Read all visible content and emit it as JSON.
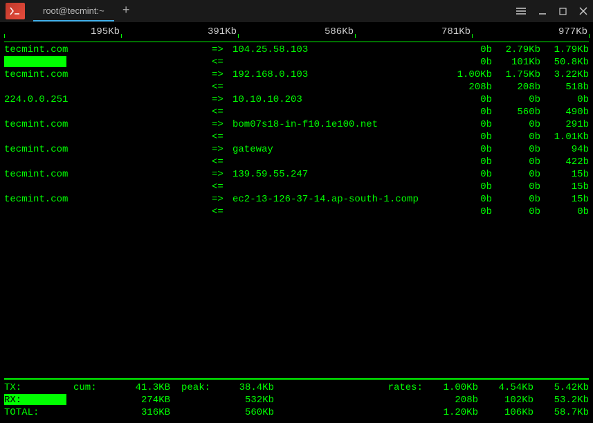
{
  "window": {
    "tab_title": "root@tecmint:~"
  },
  "scale": {
    "ticks": [
      "195Kb",
      "391Kb",
      "586Kb",
      "781Kb",
      "977Kb"
    ]
  },
  "connections": [
    {
      "host": "tecmint.com",
      "arrow_out": "=>",
      "remote": "104.25.58.103",
      "out": [
        "0b",
        "2.79Kb",
        "1.79Kb"
      ],
      "arrow_in": "<=",
      "in": [
        "0b",
        "101Kb",
        "50.8Kb"
      ],
      "host_in_bar": true
    },
    {
      "host": "tecmint.com",
      "arrow_out": "=>",
      "remote": "192.168.0.103",
      "out": [
        "1.00Kb",
        "1.75Kb",
        "3.22Kb"
      ],
      "arrow_in": "<=",
      "in": [
        "208b",
        "208b",
        "518b"
      ]
    },
    {
      "host": "224.0.0.251",
      "arrow_out": "=>",
      "remote": "10.10.10.203",
      "out": [
        "0b",
        "0b",
        "0b"
      ],
      "arrow_in": "<=",
      "in": [
        "0b",
        "560b",
        "490b"
      ]
    },
    {
      "host": "tecmint.com",
      "arrow_out": "=>",
      "remote": "bom07s18-in-f10.1e100.net",
      "out": [
        "0b",
        "0b",
        "291b"
      ],
      "arrow_in": "<=",
      "in": [
        "0b",
        "0b",
        "1.01Kb"
      ]
    },
    {
      "host": "tecmint.com",
      "arrow_out": "=>",
      "remote": "gateway",
      "out": [
        "0b",
        "0b",
        "94b"
      ],
      "arrow_in": "<=",
      "in": [
        "0b",
        "0b",
        "422b"
      ]
    },
    {
      "host": "tecmint.com",
      "arrow_out": "=>",
      "remote": "139.59.55.247",
      "out": [
        "0b",
        "0b",
        "15b"
      ],
      "arrow_in": "<=",
      "in": [
        "0b",
        "0b",
        "15b"
      ]
    },
    {
      "host": "tecmint.com",
      "arrow_out": "=>",
      "remote": "ec2-13-126-37-14.ap-south-1.comp",
      "out": [
        "0b",
        "0b",
        "15b"
      ],
      "arrow_in": "<=",
      "in": [
        "0b",
        "0b",
        "0b"
      ]
    }
  ],
  "footer": {
    "cum_label": "cum:",
    "peak_label": "peak:",
    "rates_label": "rates:",
    "tx": {
      "label": "TX:",
      "cum": "41.3KB",
      "peak": "38.4Kb",
      "rates": [
        "1.00Kb",
        "4.54Kb",
        "5.42Kb"
      ]
    },
    "rx": {
      "label": "RX:",
      "cum": "274KB",
      "peak": "532Kb",
      "rates": [
        "208b",
        "102Kb",
        "53.2Kb"
      ]
    },
    "total": {
      "label": "TOTAL:",
      "cum": "316KB",
      "peak": "560Kb",
      "rates": [
        "1.20Kb",
        "106Kb",
        "58.7Kb"
      ]
    }
  }
}
